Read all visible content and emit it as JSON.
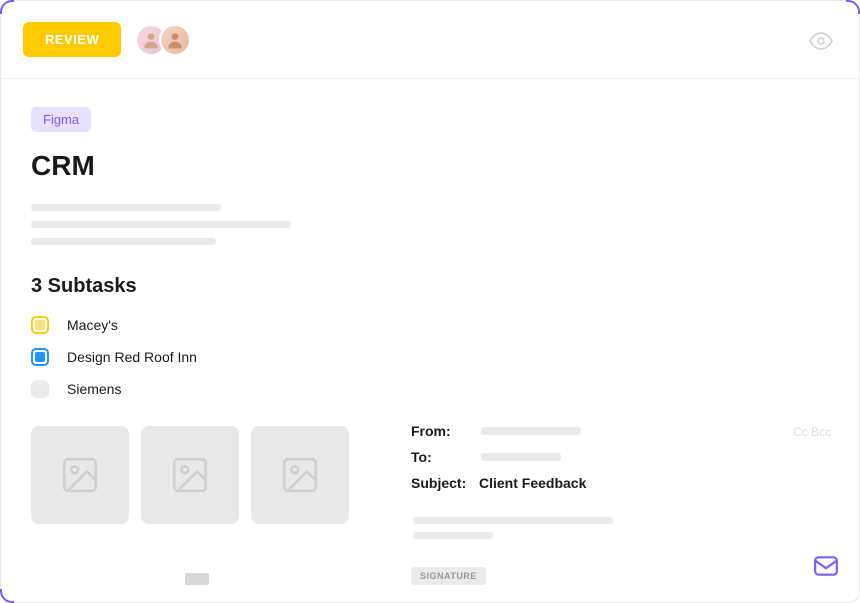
{
  "header": {
    "review_label": "REVIEW"
  },
  "task": {
    "tag": "Figma",
    "title": "CRM"
  },
  "subtasks": {
    "heading": "3 Subtasks",
    "items": [
      {
        "label": "Macey's",
        "color": "yellow"
      },
      {
        "label": "Design Red Roof Inn",
        "color": "blue"
      },
      {
        "label": "Siemens",
        "color": "gray"
      }
    ]
  },
  "email": {
    "from_label": "From:",
    "to_label": "To:",
    "subject_label": "Subject:",
    "subject_value": "Client Feedback",
    "cc_bcc": "Cc Bcc",
    "signature_label": "SIGNATURE"
  }
}
